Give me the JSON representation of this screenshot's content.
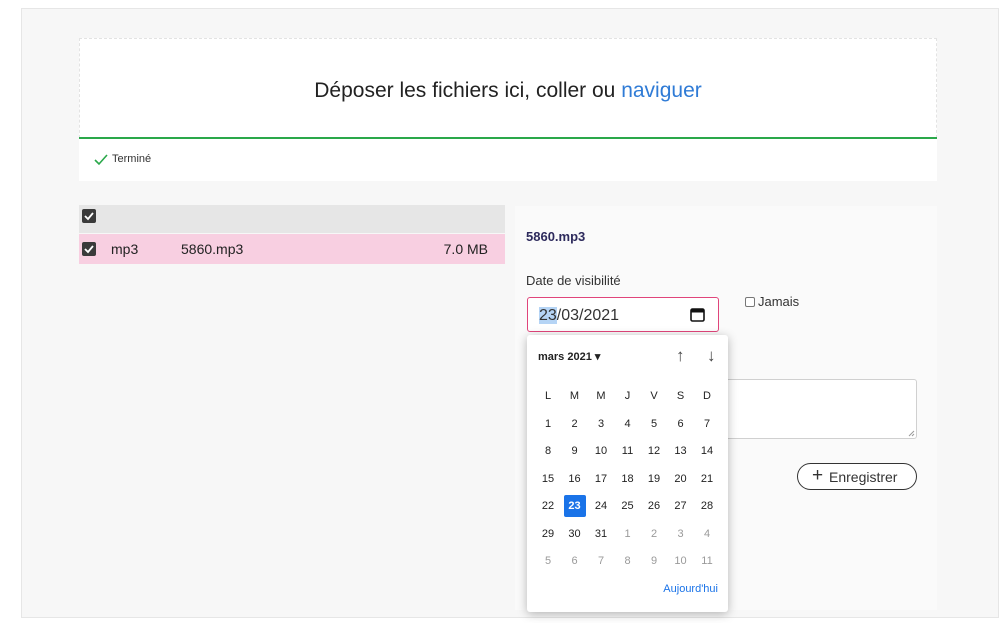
{
  "dropzone": {
    "text": "Déposer les fichiers ici, coller ou",
    "link": "naviguer"
  },
  "status": {
    "label": "Terminé",
    "progress_fraction": 1.0
  },
  "file_table": {
    "rows": [
      {
        "checked": true,
        "type": "mp3",
        "name": "5860.mp3",
        "size": "7.0 MB"
      }
    ]
  },
  "detail": {
    "title": "5860.mp3",
    "visibility_label": "Date de visibilité",
    "date": {
      "day": "23",
      "rest": "/03/2021"
    },
    "never_label": "Jamais",
    "save_label": "Enregistrer"
  },
  "datepicker": {
    "month": "mars 2021 ▾",
    "weekdays": [
      "L",
      "M",
      "M",
      "J",
      "V",
      "S",
      "D"
    ],
    "weeks": [
      [
        "1",
        "2",
        "3",
        "4",
        "5",
        "6",
        "7"
      ],
      [
        "8",
        "9",
        "10",
        "11",
        "12",
        "13",
        "14"
      ],
      [
        "15",
        "16",
        "17",
        "18",
        "19",
        "20",
        "21"
      ],
      [
        "22",
        "23",
        "24",
        "25",
        "26",
        "27",
        "28"
      ],
      [
        "29",
        "30",
        "31",
        "1",
        "2",
        "3",
        "4"
      ],
      [
        "5",
        "6",
        "7",
        "8",
        "9",
        "10",
        "11"
      ]
    ],
    "selected_day": "23",
    "today_label": "Aujourd'hui"
  },
  "colors": {
    "accent_link": "#2f7bd6",
    "progress": "#2aa84a",
    "selected_row": "#f8cfe1",
    "date_border": "#e0457b",
    "calendar_selected": "#1a73e8"
  }
}
